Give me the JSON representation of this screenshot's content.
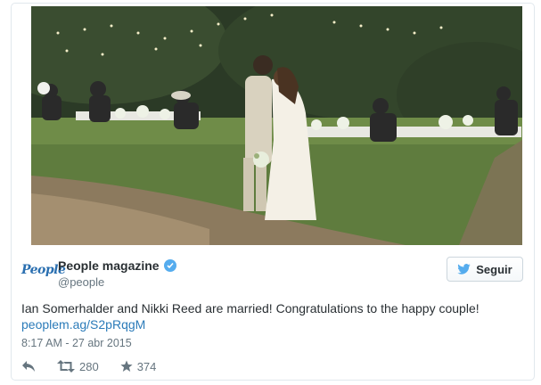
{
  "tweet": {
    "logo_text": "People",
    "author_name": "People magazine",
    "handle": "@people",
    "text": "Ian Somerhalder and Nikki Reed are married! Congratulations to the happy couple!",
    "link": "peoplem.ag/S2pRqgM",
    "timestamp": "8:17 AM - 27 abr 2015",
    "follow_label": "Seguir",
    "retweets": "280",
    "favorites": "374"
  },
  "icons": {
    "verified": "verified-badge-icon",
    "follow": "bird-icon",
    "reply": "reply-icon",
    "retweet": "retweet-icon",
    "favorite": "star-icon"
  },
  "colors": {
    "link": "#2b7bb9",
    "verified": "#55acee",
    "brand_logo": "#2a6fb0",
    "muted": "#66757f"
  }
}
